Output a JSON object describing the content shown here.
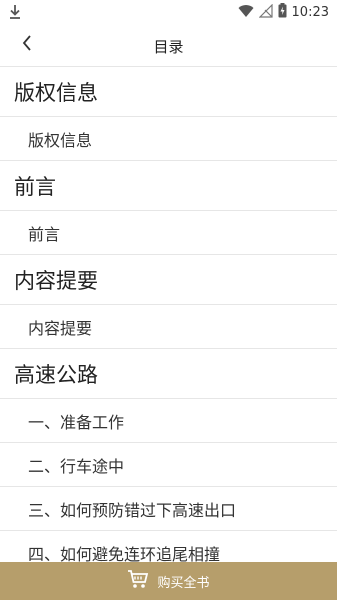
{
  "status_bar": {
    "time": "10:23",
    "icons": [
      "download-icon",
      "wifi-icon",
      "no-signal-icon",
      "battery-charging-icon"
    ]
  },
  "app_bar": {
    "title": "目录",
    "back_icon": "chevron-left-icon"
  },
  "toc": {
    "items": [
      {
        "label": "版权信息",
        "level": 1
      },
      {
        "label": "版权信息",
        "level": 2
      },
      {
        "label": "前言",
        "level": 1
      },
      {
        "label": "前言",
        "level": 2
      },
      {
        "label": "内容提要",
        "level": 1
      },
      {
        "label": "内容提要",
        "level": 2
      },
      {
        "label": "高速公路",
        "level": 1
      },
      {
        "label": "一、准备工作",
        "level": 2
      },
      {
        "label": "二、行车途中",
        "level": 2
      },
      {
        "label": "三、如何预防错过下高速出口",
        "level": 2
      },
      {
        "label": "四、如何避免连环追尾相撞",
        "level": 2
      }
    ]
  },
  "buy_bar": {
    "label": "购买全书",
    "icon": "cart-icon"
  },
  "colors": {
    "buy_bar_bg": "#b69e6b",
    "divider": "#e6e6e6"
  }
}
